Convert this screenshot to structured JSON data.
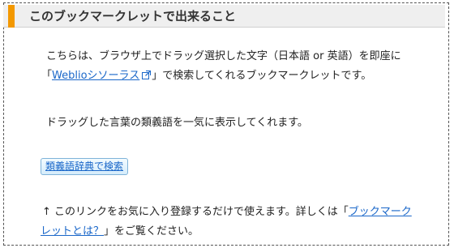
{
  "section": {
    "title": "このブックマークレットで出来ること"
  },
  "intro": {
    "text_before": "こちらは、ブラウザ上でドラッグ選択した文字（日本語 or 英語）を即座に",
    "open_bracket": "「",
    "link_label": "Weblioシソーラス",
    "text_after": "」で検索してくれるブックマークレットです。"
  },
  "description": "ドラッグした言葉の類義語を一気に表示してくれます。",
  "bookmarklet_button": {
    "label": "類義語辞典で検索"
  },
  "usage": {
    "text_before": "↑ このリンクをお気に入り登録するだけで使えます。詳しくは「",
    "link_label_line1": "ブックマーク",
    "link_label_line2": "レットとは？",
    "text_after": "」をご覧ください。"
  },
  "colors": {
    "accent": "#f39800",
    "link": "#1a67c9",
    "header_bg": "#efefef"
  },
  "icons": {
    "external_link": "external-link-icon"
  }
}
